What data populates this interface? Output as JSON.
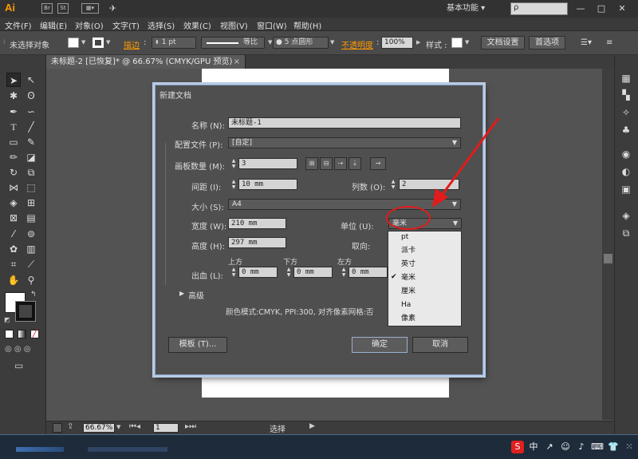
{
  "app": {
    "logo": "Ai",
    "workspace": "基本功能",
    "search_placeholder": "ρ",
    "window_buttons": [
      "—",
      "□",
      "✕"
    ]
  },
  "menu": [
    "文件(F)",
    "编辑(E)",
    "对象(O)",
    "文字(T)",
    "选择(S)",
    "效果(C)",
    "视图(V)",
    "窗口(W)",
    "帮助(H)"
  ],
  "control": {
    "selection": "未选择对象",
    "stroke_label": "描边",
    "stroke_value": "1 pt",
    "profile": "等比",
    "brush": "5 点圆形",
    "opacity_label": "不透明度",
    "opacity_value": "100%",
    "style_label": "样式",
    "doc_setup": "文档设置",
    "preferences": "首选项"
  },
  "tab": {
    "title": "未标题-2 [已恢复]* @ 66.67% (CMYK/GPU 预览)",
    "close": "×"
  },
  "dialog": {
    "title": "新建文档",
    "name_label": "名称 (N):",
    "name_value": "未标题-1",
    "profile_label": "配置文件 (P):",
    "profile_value": "[自定]",
    "artboards_label": "画板数量 (M):",
    "artboards_value": "3",
    "spacing_label": "间距 (I):",
    "spacing_value": "10 mm",
    "columns_label": "列数 (O):",
    "columns_value": "2",
    "size_label": "大小 (S):",
    "size_value": "A4",
    "width_label": "宽度 (W):",
    "width_value": "210 mm",
    "units_label": "单位 (U):",
    "units_value": "毫米",
    "height_label": "高度 (H):",
    "height_value": "297 mm",
    "orientation_label": "取向:",
    "bleed_label": "出血 (L):",
    "bleed_top_label": "上方",
    "bleed_bottom_label": "下方",
    "bleed_left_label": "左方",
    "bleed_top": "0 mm",
    "bleed_bottom": "0 mm",
    "bleed_left": "0 mm",
    "advanced_label": "高级",
    "info": "颜色模式:CMYK, PPI:300, 对齐像素网格:否",
    "templates_button": "模板 (T)...",
    "ok_button": "确定",
    "cancel_button": "取消",
    "units_options": [
      "pt",
      "派卡",
      "英寸",
      "毫米",
      "厘米",
      "Ha",
      "像素"
    ],
    "units_selected_index": 3
  },
  "status": {
    "zoom": "66.67%",
    "artboard": "1",
    "tool": "选择"
  },
  "colors": {
    "accent_orange": "#ff9a00",
    "annotation_red": "#e21b1b",
    "dialog_border": "#8aa5c8"
  }
}
